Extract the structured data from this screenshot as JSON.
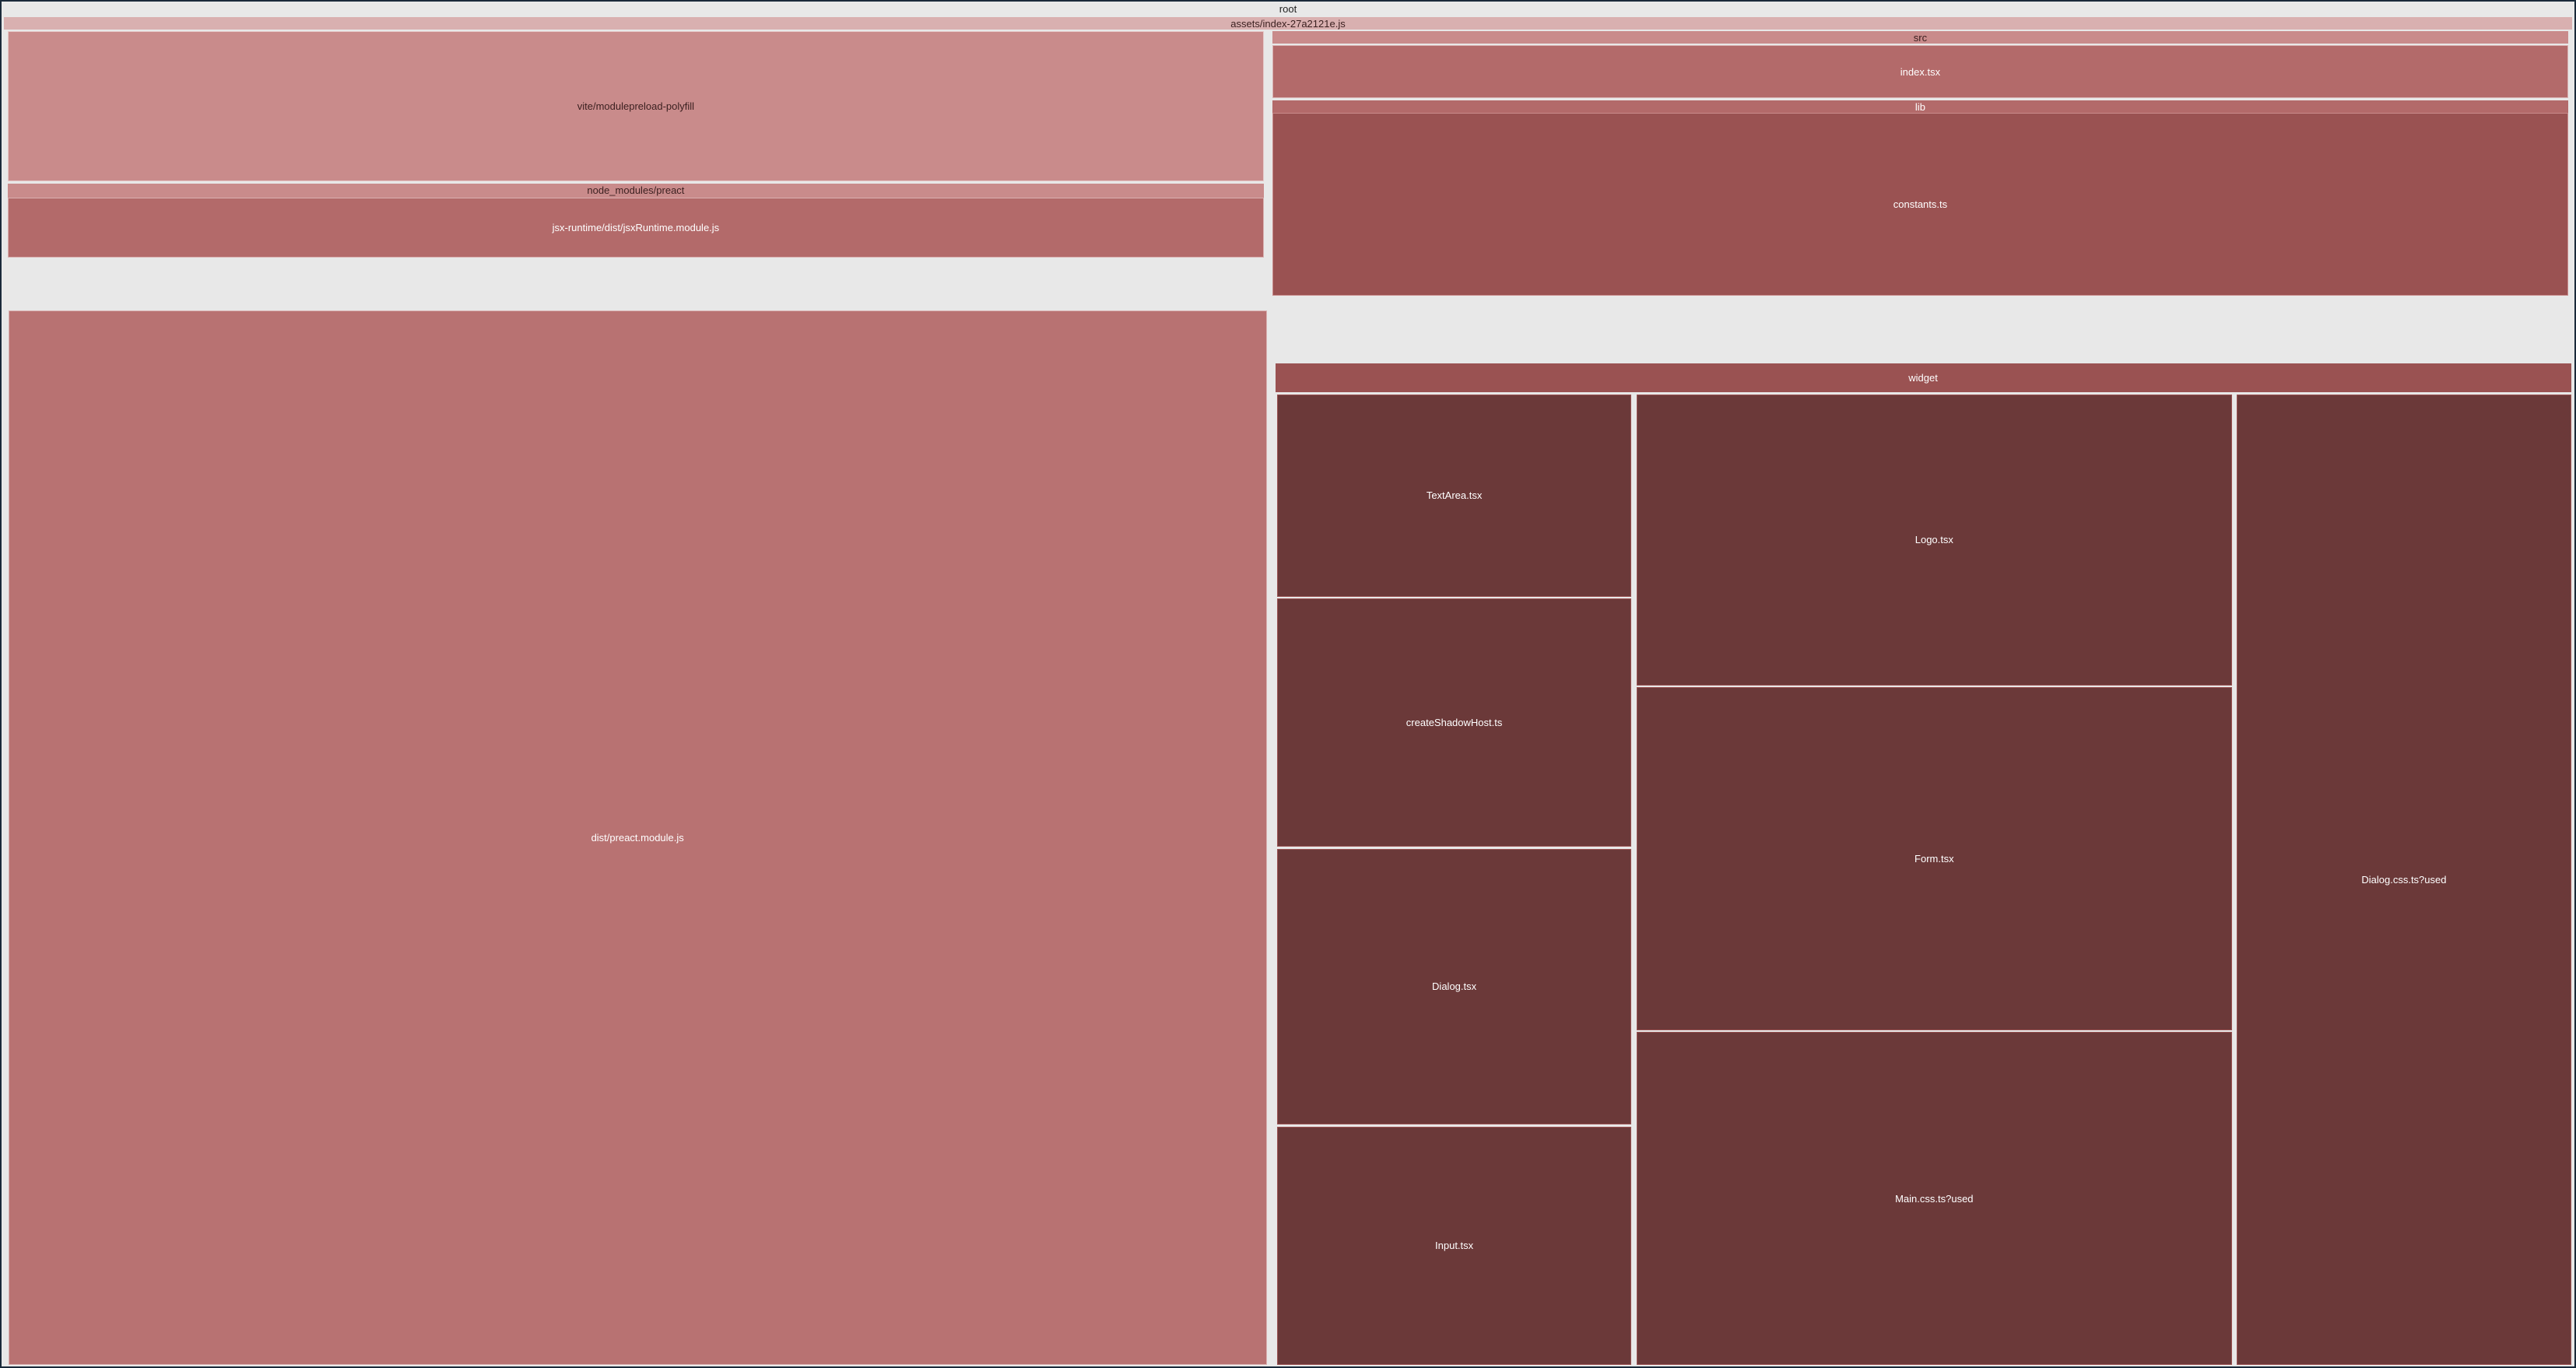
{
  "chart_data": {
    "type": "treemap",
    "title": "root",
    "root": {
      "name": "root",
      "children": [
        {
          "name": "assets/index-27a2121e.js",
          "children": [
            {
              "name": "vite/modulepreload-polyfill",
              "value": 88
            },
            {
              "name": "node_modules/preact",
              "children": [
                {
                  "name": "jsx-runtime/dist/jsxRuntime.module.js",
                  "value": 35
                },
                {
                  "name": "dist/preact.module.js",
                  "value": 620
                }
              ]
            },
            {
              "name": "src",
              "children": [
                {
                  "name": "index.tsx",
                  "value": 31
                },
                {
                  "name": "lib",
                  "children": [
                    {
                      "name": "constants.ts",
                      "value": 107
                    }
                  ]
                },
                {
                  "name": "widget",
                  "children": [
                    {
                      "name": "TextArea.tsx",
                      "value": 118
                    },
                    {
                      "name": "createShadowHost.ts",
                      "value": 145
                    },
                    {
                      "name": "Dialog.tsx",
                      "value": 162
                    },
                    {
                      "name": "Input.tsx",
                      "value": 144
                    },
                    {
                      "name": "Logo.tsx",
                      "value": 170
                    },
                    {
                      "name": "Form.tsx",
                      "value": 200
                    },
                    {
                      "name": "Main.css.ts?used",
                      "value": 194
                    },
                    {
                      "name": "Dialog.css.ts?used",
                      "value": 565
                    }
                  ]
                }
              ]
            }
          ]
        }
      ]
    }
  },
  "labels": {
    "root": "root",
    "assets": "assets/index-27a2121e.js",
    "vite": "vite/modulepreload-polyfill",
    "preact": "node_modules/preact",
    "jsxRuntime": "jsx-runtime/dist/jsxRuntime.module.js",
    "preactModule": "dist/preact.module.js",
    "src": "src",
    "indexTsx": "index.tsx",
    "lib": "lib",
    "constants": "constants.ts",
    "widget": "widget",
    "textArea": "TextArea.tsx",
    "createShadowHost": "createShadowHost.ts",
    "dialog": "Dialog.tsx",
    "input": "Input.tsx",
    "logo": "Logo.tsx",
    "form": "Form.tsx",
    "mainCss": "Main.css.ts?used",
    "dialogCss": "Dialog.css.ts?used"
  }
}
